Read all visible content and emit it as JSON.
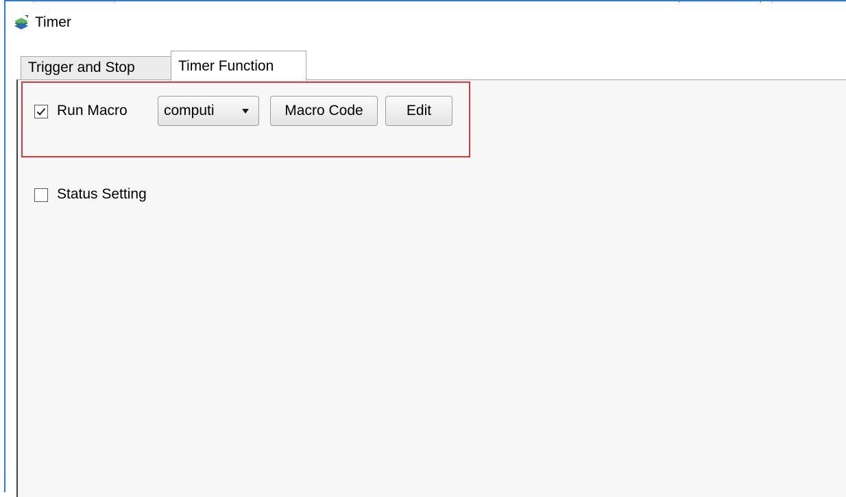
{
  "window": {
    "title": "Timer",
    "icon": "app-icon"
  },
  "tabs": [
    {
      "label": "Trigger and Stop",
      "active": false
    },
    {
      "label": "Timer Function",
      "active": true
    }
  ],
  "run_macro": {
    "label": "Run Macro",
    "checked": true,
    "selected_macro": "computi",
    "macro_code_label": "Macro Code",
    "edit_label": "Edit"
  },
  "status_setting": {
    "label": "Status Setting",
    "checked": false
  },
  "colors": {
    "highlight_border": "#d9373b",
    "window_border": "#2b7bd3"
  }
}
